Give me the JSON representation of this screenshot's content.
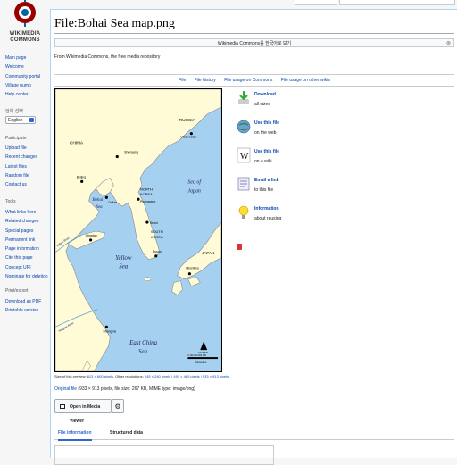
{
  "logo": {
    "text_line1": "WIKIMEDIA",
    "text_line2": "COMMONS"
  },
  "sidebar": {
    "nav_items": [
      "Main page",
      "Welcome",
      "Community portal",
      "Village pump",
      "Help center"
    ],
    "language_heading": "언어 선택",
    "language_value": "English",
    "participate_heading": "Participate",
    "participate_items": [
      "Upload file",
      "Recent changes",
      "Latest files",
      "Random file",
      "Contact us"
    ],
    "tools_heading": "Tools",
    "tools_items": [
      "What links here",
      "Related changes",
      "Special pages",
      "Permanent link",
      "Page information",
      "Cite this page",
      "Concept URI",
      "Nominate for deletion"
    ],
    "print_heading": "Print/export",
    "print_items": [
      "Download as PDF",
      "Printable version"
    ]
  },
  "page": {
    "title": "File:Bohai Sea map.png",
    "notice": "Wikimedia Commons를 한국어로 보기",
    "notice_close": "⊗",
    "from": "From Wikimedia Commons, the free media repository",
    "tabs": [
      "File",
      "File history",
      "File usage on Commons",
      "File usage on other wikis"
    ]
  },
  "map": {
    "labels": {
      "china": "CHINA",
      "russia": "RUSSIA",
      "vladivostok": "Vladivostok",
      "shenyang": "Shenyang",
      "beijing": "Beijing",
      "dalian": "Dalian",
      "bohai": "Bohai",
      "sea": "Sea",
      "north_korea_1": "NORTH",
      "north_korea_2": "KOREA",
      "pyongyang": "Pyongyang",
      "sea_of": "Sea of",
      "japan_sea": "Japan",
      "seoul": "Seoul",
      "south_korea_1": "SOUTH",
      "south_korea_2": "KOREA",
      "qingdao": "Qingdao",
      "yellow_river": "Yellow River",
      "busan": "Busan",
      "yellow": "Yellow",
      "yellow_sea": "Sea",
      "japan": "JAPAN",
      "hiroshima": "Hiroshima",
      "yangtze": "Yangtze River",
      "shanghai": "Shanghai",
      "east_china": "East China",
      "east_china_sea": "Sea",
      "north": "NORTH",
      "scale": "0  100 200 300 400",
      "km": "Kilometres"
    }
  },
  "actions": [
    {
      "title": "Download",
      "sub": "all sizes",
      "icon": "download-icon"
    },
    {
      "title": "Use this file",
      "sub": "on the web",
      "icon": "globe-icon"
    },
    {
      "title": "Use this file",
      "sub": "on a wiki",
      "icon": "wiki-icon"
    },
    {
      "title": "Email a link",
      "sub": "to this file",
      "icon": "email-icon"
    },
    {
      "title": "Information",
      "sub": "about reusing",
      "icon": "lightbulb-icon"
    }
  ],
  "caption": {
    "prefix": "Size of this preview:",
    "preview": "613 × 600 pixels",
    "other": ". Other resolutions:",
    "res": "245 × 240 pixels | 491 × 480 pixels | 933 × 913 pixels",
    "end": "."
  },
  "original": {
    "link": "Original file",
    "details": "(933 × 913 pixels, file size: 267 KB, MIME type: image/png)"
  },
  "media_viewer_button": "Open in Media Viewer",
  "gear_symbol": "⚙",
  "file_tabs": [
    "File information",
    "Structured data"
  ],
  "colors": {
    "sea": "#a6d0f0",
    "land": "#fffbd6",
    "link": "#0645ad",
    "accent": "#3366cc"
  }
}
